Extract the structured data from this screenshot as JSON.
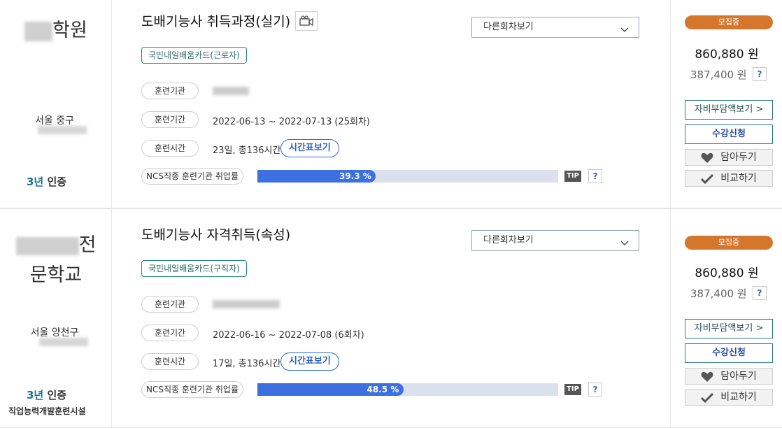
{
  "courses": [
    {
      "institution": {
        "name_suffix": "학원",
        "region": "서울 중구",
        "cert_years": "3년",
        "cert_label": "인증",
        "facility": ""
      },
      "title": "도배기능사 취득과정(실기)",
      "other_round_select": "다른회차보기",
      "card_tag": "국민내일배움카드(근로자)",
      "rows": {
        "institution_label": "훈련기관",
        "period_label": "훈련기간",
        "period_value": "2022-06-13 ~ 2022-07-13 (25회차)",
        "time_label": "훈련시간",
        "time_value": "23일, 총136시간",
        "timetable_button": "시간표보기",
        "ncs_label": "NCS직종 훈련기관 취업률",
        "ncs_rate_text": "39.3 %",
        "ncs_rate": 39.3,
        "tip": "TIP",
        "help": "?"
      },
      "price": {
        "badge": "모집중",
        "total": "860,880 원",
        "self_pay": "387,400 원",
        "help": "?",
        "self_pay_button": "자비부담액보기 >",
        "apply_button": "수강신청",
        "save_button": "담아두기",
        "compare_button": "비교하기"
      }
    },
    {
      "institution": {
        "name_line1_suffix": "전",
        "name_line2": "문학교",
        "region": "서울 양천구",
        "cert_years": "3년",
        "cert_label": "인증",
        "facility": "직업능력개발훈련시설"
      },
      "title": "도배기능사 자격취득(속성)",
      "other_round_select": "다른회차보기",
      "card_tag": "국민내일배움카드(구직자)",
      "rows": {
        "institution_label": "훈련기관",
        "period_label": "훈련기간",
        "period_value": "2022-06-16 ~ 2022-07-08 (6회차)",
        "time_label": "훈련시간",
        "time_value": "17일, 총136시간",
        "timetable_button": "시간표보기",
        "ncs_label": "NCS직종 훈련기관 취업률",
        "ncs_rate_text": "48.5 %",
        "ncs_rate": 48.5,
        "tip": "TIP",
        "help": "?"
      },
      "price": {
        "badge": "모집중",
        "total": "860,880 원",
        "self_pay": "387,400 원",
        "help": "?",
        "self_pay_button": "자비부담액보기 >",
        "apply_button": "수강신청",
        "save_button": "담아두기",
        "compare_button": "비교하기"
      }
    }
  ],
  "colors": {
    "accent": "#3c6fe0",
    "badge": "#d4772c",
    "teal": "#2a7e73"
  },
  "icons": [
    "video-camera-icon",
    "chevron-down-icon",
    "heart-icon",
    "check-icon"
  ]
}
